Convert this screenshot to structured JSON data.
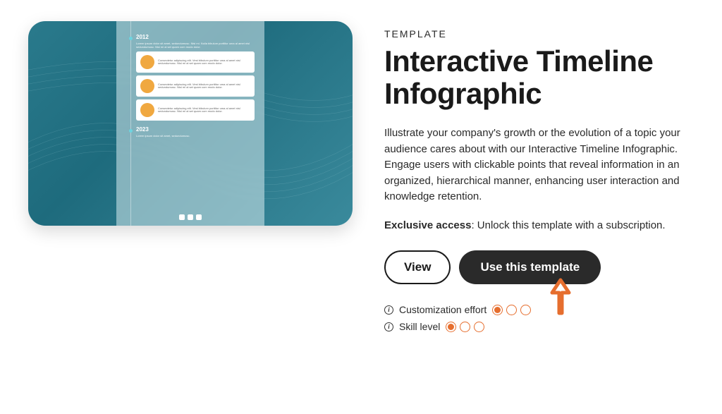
{
  "category": "TEMPLATE",
  "title": "Interactive Timeline Infographic",
  "description": "Illustrate your company's growth or the evolution of a topic your audience cares about with our Interactive Timeline Infographic. Engage users with clickable points that reveal information in an organized, hierarchical manner, enhancing user interaction and knowledge retention.",
  "access": {
    "label": "Exclusive access",
    "text": ": Unlock this template with a subscription."
  },
  "buttons": {
    "view": "View",
    "use": "Use this template"
  },
  "metrics": {
    "customization": {
      "label": "Customization effort",
      "rating": 1,
      "max": 3
    },
    "skill": {
      "label": "Skill level",
      "rating": 1,
      "max": 3
    }
  },
  "preview": {
    "years": [
      {
        "year": "2012",
        "desc": "Lorem ipsum dolor sit amet, sedundumusc.\nNisl mi. Nulla bibulum porttitor uma al amet nisl sedundumusc.\nNisl mi al set quam com modo dolor.",
        "entries": [
          {
            "text": "Consectetur adipiscing elit. Vest bibulum porttitor uma al amet nisl sedundumusc. Nisl mi al set quam com modo dolor."
          },
          {
            "text": "Consectetur adipiscing elit. Vest bibulum porttitor uma al amet nisl sedundumusc. Nisl mi al set quam com modo dolor."
          },
          {
            "text": "Consectetur adipiscing elit. Vest bibulum porttitor uma al amet nisl sedundumusc. Nisl mi al set quam com modo dolor."
          }
        ]
      },
      {
        "year": "2023",
        "desc": "Lorem ipsum dolor sit amet, sedundumusc.",
        "entries": []
      }
    ]
  }
}
